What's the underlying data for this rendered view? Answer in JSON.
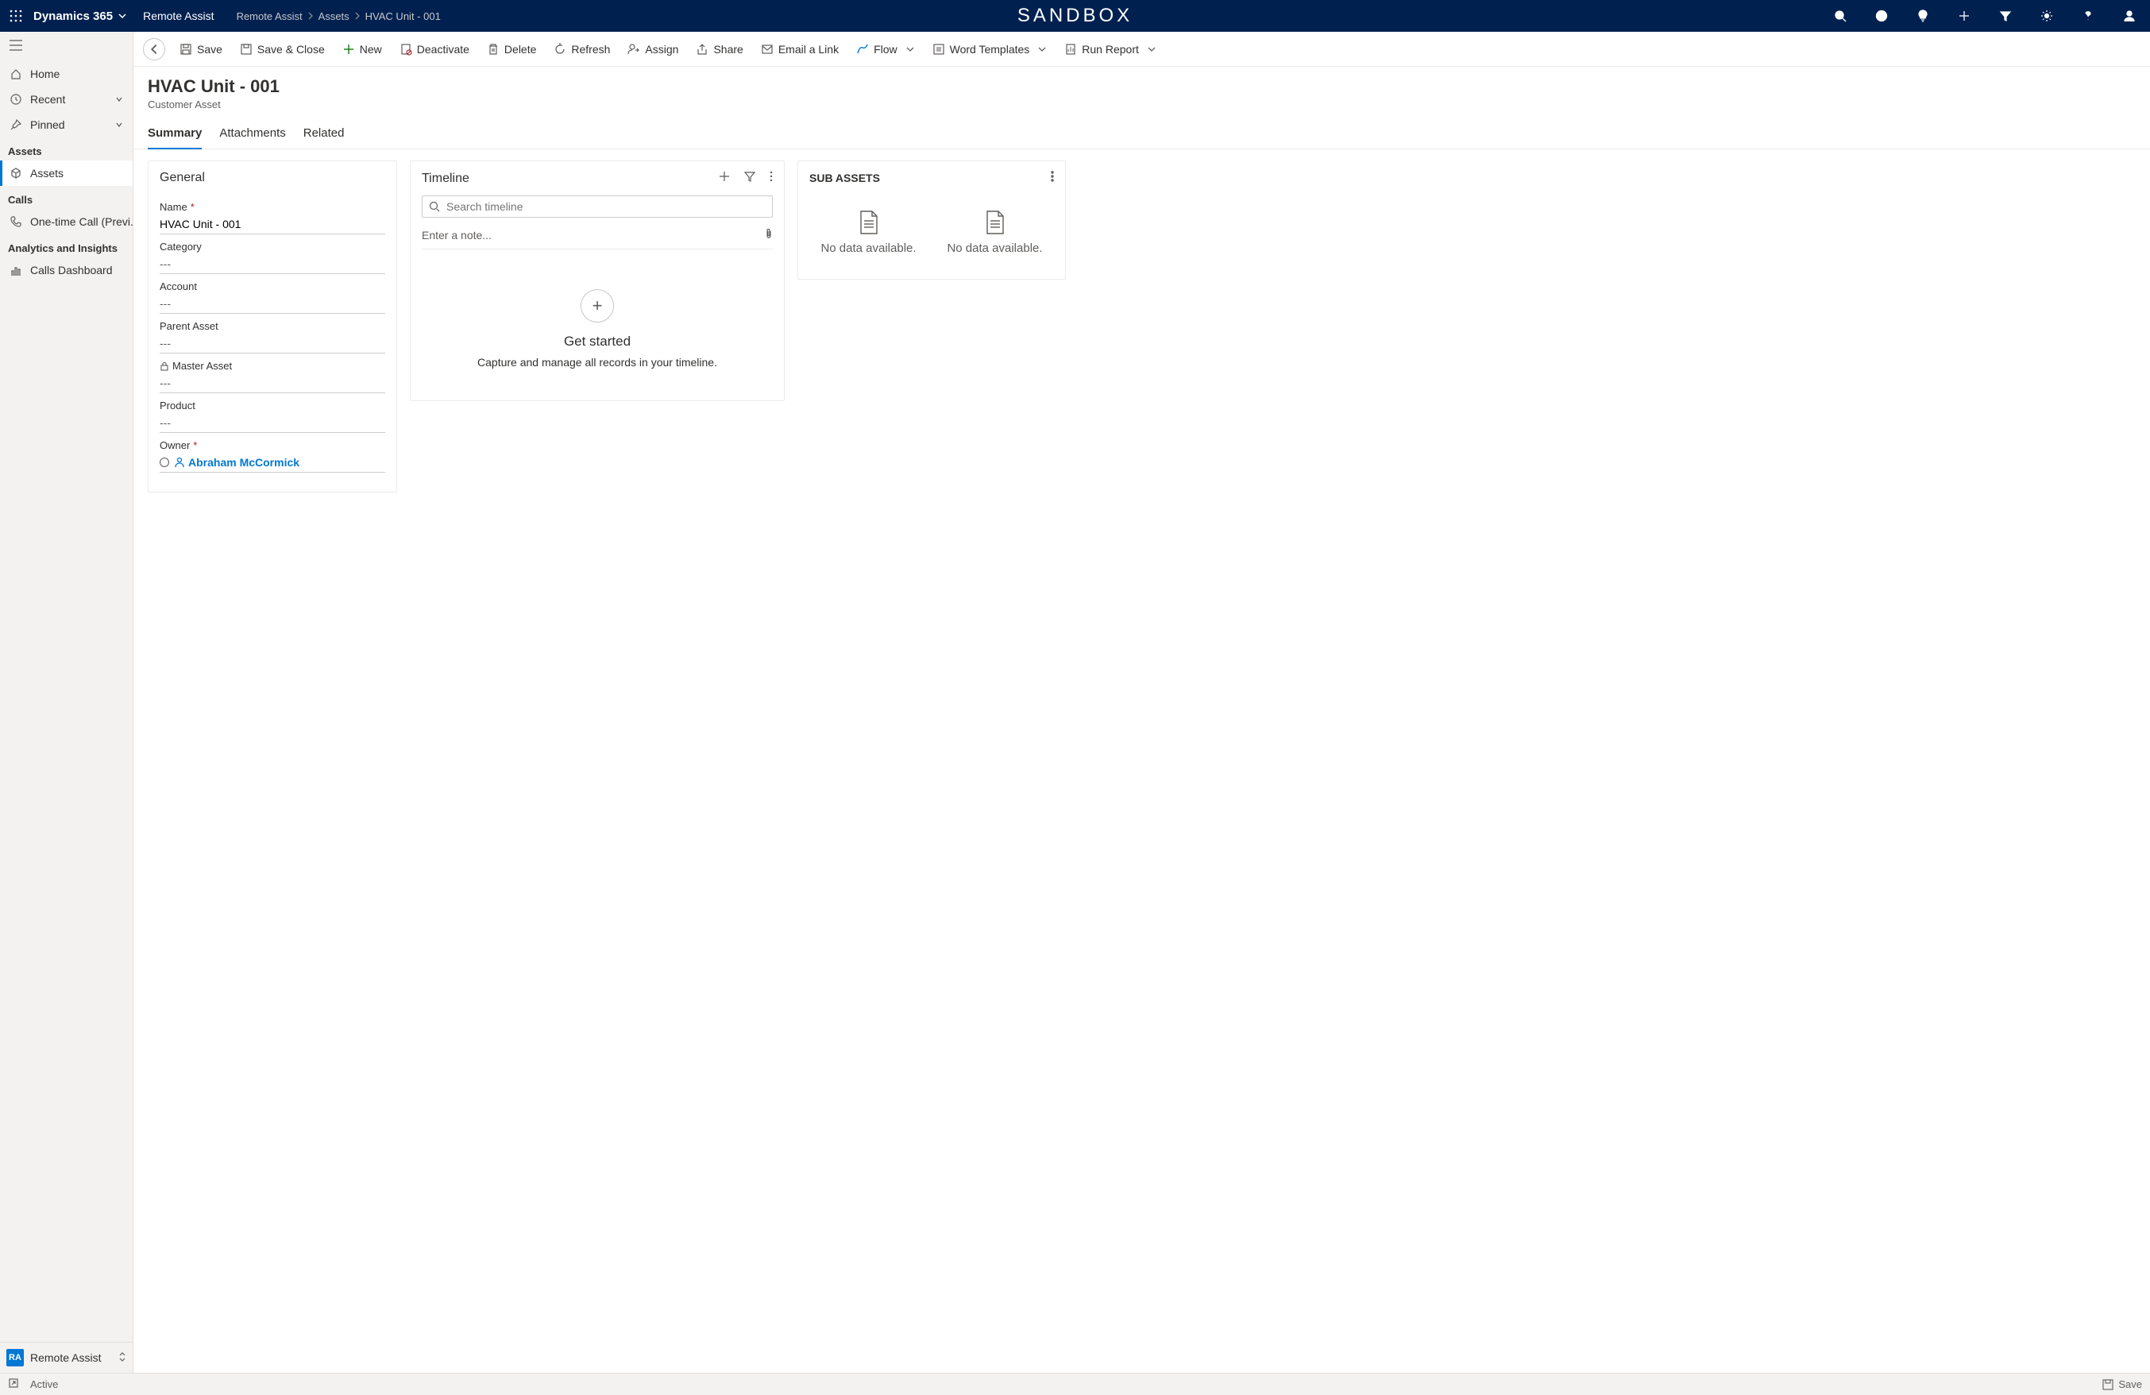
{
  "topbar": {
    "brand": "Dynamics 365",
    "app": "Remote Assist",
    "env": "SANDBOX",
    "breadcrumbs": [
      "Remote Assist",
      "Assets",
      "HVAC Unit - 001"
    ]
  },
  "sidebar": {
    "items": {
      "home": "Home",
      "recent": "Recent",
      "pinned": "Pinned"
    },
    "groups": {
      "assets": "Assets",
      "calls": "Calls",
      "analytics": "Analytics and Insights"
    },
    "assets_item": "Assets",
    "calls_item": "One-time Call (Previ...",
    "analytics_item": "Calls Dashboard",
    "footer_badge": "RA",
    "footer_label": "Remote Assist"
  },
  "commands": {
    "save": "Save",
    "saveclose": "Save & Close",
    "new": "New",
    "deactivate": "Deactivate",
    "delete": "Delete",
    "refresh": "Refresh",
    "assign": "Assign",
    "share": "Share",
    "emaillink": "Email a Link",
    "flow": "Flow",
    "wordtemplates": "Word Templates",
    "runreport": "Run Report"
  },
  "record": {
    "title": "HVAC Unit - 001",
    "subtitle": "Customer Asset"
  },
  "tabs": {
    "summary": "Summary",
    "attachments": "Attachments",
    "related": "Related"
  },
  "general": {
    "section": "General",
    "fields": {
      "name_label": "Name",
      "name_value": "HVAC Unit - 001",
      "category_label": "Category",
      "category_value": "---",
      "account_label": "Account",
      "account_value": "---",
      "parent_label": "Parent Asset",
      "parent_value": "---",
      "master_label": "Master Asset",
      "master_value": "---",
      "product_label": "Product",
      "product_value": "---",
      "owner_label": "Owner",
      "owner_value": "Abraham McCormick"
    }
  },
  "timeline": {
    "title": "Timeline",
    "search_placeholder": "Search timeline",
    "note_placeholder": "Enter a note...",
    "empty_title": "Get started",
    "empty_sub": "Capture and manage all records in your timeline."
  },
  "subassets": {
    "title": "SUB ASSETS",
    "nodata": "No data available."
  },
  "statusbar": {
    "status": "Active",
    "save": "Save"
  }
}
